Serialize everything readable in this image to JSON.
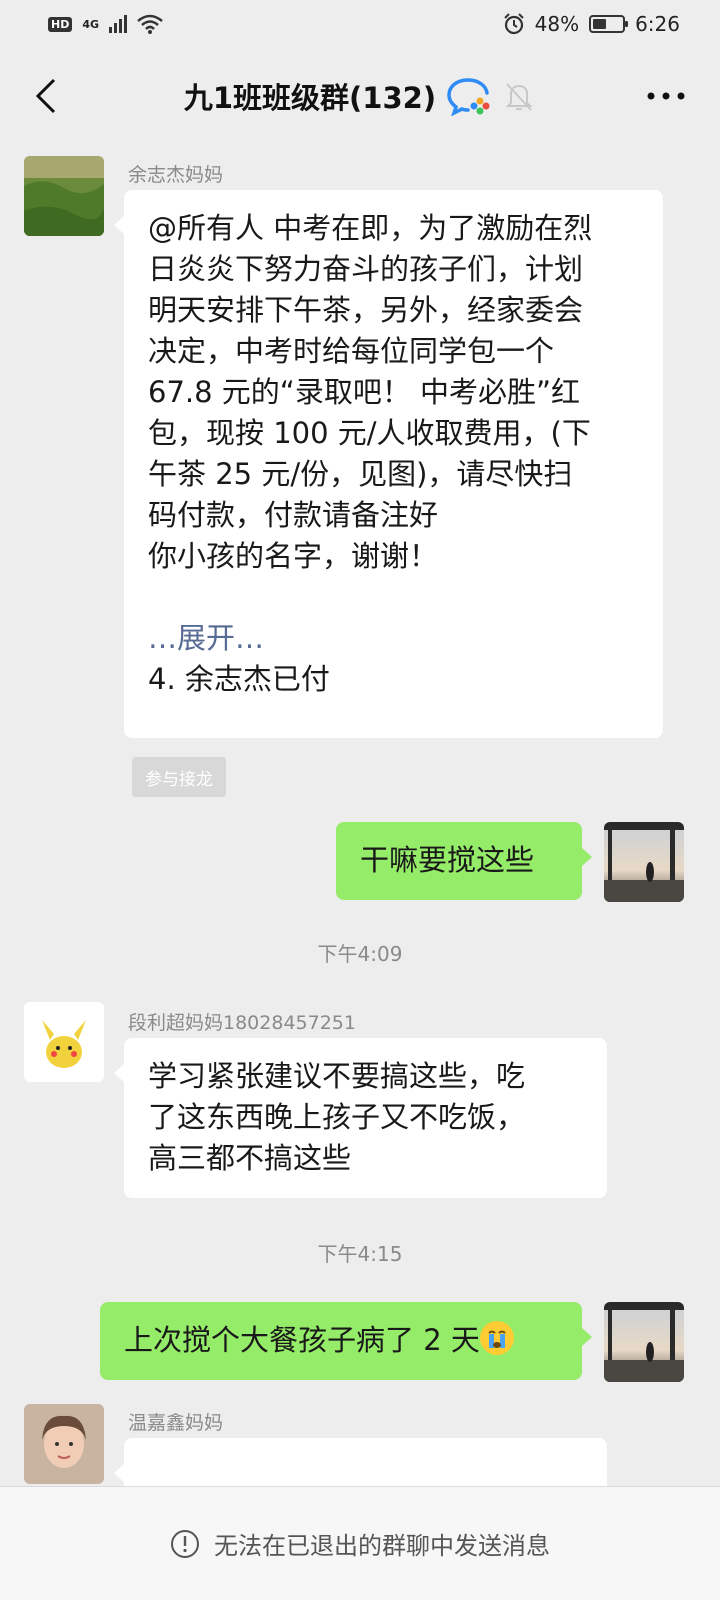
{
  "status_bar": {
    "left": {
      "hd": "HD",
      "network": "4G"
    },
    "battery_percent": "48%",
    "battery_level": 0.48,
    "time": "6:26"
  },
  "nav": {
    "title": "九1班班级群(132)"
  },
  "messages": [
    {
      "sender": "余志杰妈妈",
      "lines": [
        "@所有人 中考在即，为了激励在烈",
        "日炎炎下努力奋斗的孩子们，计划",
        "明天安排下午茶，另外，经家委会",
        "决定，中考时给每位同学包一个",
        "67.8 元的“录取吧！ 中考必胜”红",
        "包，现按 100 元/人收取费用，(下",
        "午茶 25 元/份，见图)，请尽快扫",
        "码付款，付款请备注好",
        "你小孩的名字，谢谢！"
      ],
      "expand": "…展开…",
      "last_line": "4. 余志杰已付",
      "jielong_button": "参与接龙"
    },
    {
      "text": "干嘛要搅这些"
    },
    {
      "timestamp": "下午4:09"
    },
    {
      "sender": "段利超妈妈18028457251",
      "lines": [
        "学习紧张建议不要搞这些，吃",
        "了这东西晚上孩子又不吃饭，",
        "高三都不搞这些"
      ]
    },
    {
      "timestamp": "下午4:15"
    },
    {
      "text": "上次搅个大餐孩子病了 2 天",
      "emoji": "crying-face"
    },
    {
      "sender": "温嘉鑫妈妈"
    }
  ],
  "footer": {
    "text": "无法在已退出的群聊中发送消息"
  },
  "colors": {
    "background": "#ededed",
    "incoming_bubble": "#ffffff",
    "outgoing_bubble": "#95ec69",
    "link_blue": "#576b95",
    "meta_gray": "#8a8a8a"
  }
}
